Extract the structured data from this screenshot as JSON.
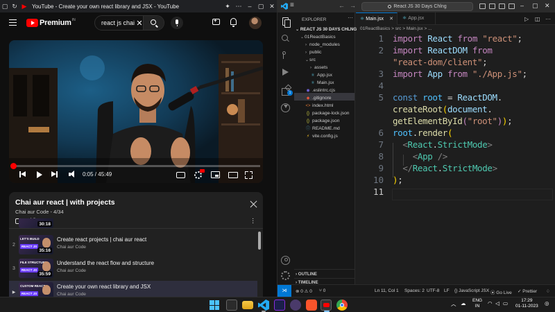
{
  "youtube": {
    "window_title": "YouTube - Create your own react library and JSX - YouTube",
    "logo_text": "Premium",
    "logo_badge": "IN",
    "search_value": "react js chai",
    "player": {
      "time": "0:05 / 45:49",
      "progress": 0.0018
    },
    "playlist": {
      "title": "Chai aur react | with projects",
      "subtitle": "Chai aur Code - 4/34",
      "items": [
        {
          "index": "",
          "title": "",
          "channel": "",
          "duration": "30:18",
          "tag": "",
          "brand": ""
        },
        {
          "index": "2",
          "title": "Create react projects | chai aur react",
          "channel": "Chai aur Code",
          "duration": "35:16",
          "tag": "LET'S BUILD",
          "brand": "REACT JS"
        },
        {
          "index": "3",
          "title": "Understand the react flow and structure",
          "channel": "Chai aur Code",
          "duration": "35:59",
          "tag": "FILE STRUCTURE",
          "brand": "REACT JS"
        },
        {
          "index": "▶",
          "title": "Create your own react library and JSX",
          "channel": "Chai aur Code",
          "duration": "",
          "tag": "CUSTOM REACT",
          "brand": "REACT JS"
        }
      ]
    }
  },
  "vscode": {
    "command_center": "React JS 30 Days Chlng",
    "explorer_label": "EXPLORER",
    "project_name": "REACT JS 30 DAYS CHLNG",
    "tree": [
      {
        "label": "01ReactBasics",
        "depth": 1,
        "kind": "folder-open",
        "icon": "⌄"
      },
      {
        "label": "node_modules",
        "depth": 2,
        "kind": "folder",
        "icon": "›"
      },
      {
        "label": "public",
        "depth": 2,
        "kind": "folder",
        "icon": "›"
      },
      {
        "label": "src",
        "depth": 2,
        "kind": "folder-open",
        "icon": "⌄"
      },
      {
        "label": "assets",
        "depth": 3,
        "kind": "folder",
        "icon": "›"
      },
      {
        "label": "App.jsx",
        "depth": 3,
        "kind": "react",
        "icon": "⚛"
      },
      {
        "label": "Main.jsx",
        "depth": 3,
        "kind": "react",
        "icon": "⚛"
      },
      {
        "label": ".eslintrc.cjs",
        "depth": 2,
        "kind": "eslint",
        "icon": "◉"
      },
      {
        "label": ".gitignore",
        "depth": 2,
        "kind": "git",
        "icon": "◆"
      },
      {
        "label": "index.html",
        "depth": 2,
        "kind": "html",
        "icon": "<>"
      },
      {
        "label": "package-lock.json",
        "depth": 2,
        "kind": "json",
        "icon": "{}"
      },
      {
        "label": "package.json",
        "depth": 2,
        "kind": "json",
        "icon": "{}"
      },
      {
        "label": "README.md",
        "depth": 2,
        "kind": "md",
        "icon": "ⓘ"
      },
      {
        "label": "vite.config.js",
        "depth": 2,
        "kind": "js",
        "icon": "⚡"
      }
    ],
    "sections": [
      "OUTLINE",
      "TIMELINE"
    ],
    "tabs": [
      {
        "label": "Main.jsx",
        "active": true
      },
      {
        "label": "App.jsx",
        "active": false
      }
    ],
    "breadcrumb": "01ReactBasics > src > Main.jsx > ...",
    "line_numbers": [
      "1",
      "2",
      "3",
      "4",
      "5",
      "6",
      "7",
      "8",
      "9",
      "10",
      "11"
    ],
    "status": {
      "errors": "⊗ 0 ⚠ 0",
      "ports": "⑂ 0",
      "position": "Ln 11, Col 1",
      "spaces": "Spaces: 2",
      "encoding": "UTF-8",
      "eol": "LF",
      "language": "{} JavaScript JSX",
      "golive": "⦿ Go Live",
      "prettier": "✓ Prettier"
    }
  },
  "taskbar": {
    "lang_top": "ENG",
    "lang_bottom": "IN",
    "time": "17:29",
    "date": "01-11-2023"
  },
  "colors": {
    "youtube_red": "#ff0000",
    "vscode_accent": "#0078d4",
    "editor_bg": "#1e1e1e"
  }
}
